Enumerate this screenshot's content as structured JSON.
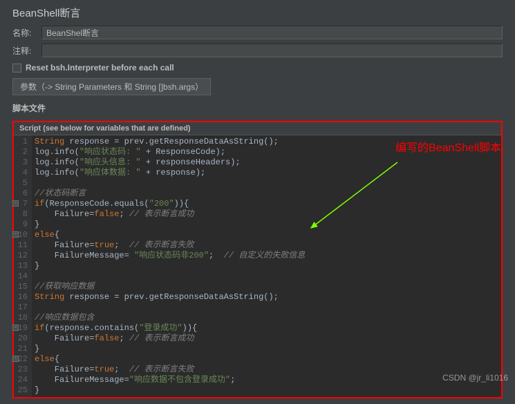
{
  "page_title": "BeanShell断言",
  "name_label": "名称:",
  "name_value": "BeanShel断言",
  "comment_label": "注释:",
  "comment_value": "",
  "reset_checkbox_label": "Reset bsh.Interpreter before each call",
  "params_label": "参数（-> String Parameters 和 String []bsh.args）",
  "script_file_label": "脚本文件",
  "script_header": "Script (see below for variables that are defined)",
  "annotation_text": "编写的BeanShell脚本",
  "watermark": "CSDN @jr_li1016",
  "chart_data": {
    "type": "table",
    "language": "java-beanshell",
    "code_lines": [
      {
        "n": 1,
        "tokens": [
          {
            "t": "kw",
            "v": "String"
          },
          {
            "t": "plain",
            "v": " response = prev.getResponseDataAsString();"
          }
        ]
      },
      {
        "n": 2,
        "tokens": [
          {
            "t": "plain",
            "v": "log.info("
          },
          {
            "t": "str",
            "v": "\"响应状态码: \""
          },
          {
            "t": "plain",
            "v": " + ResponseCode);"
          }
        ]
      },
      {
        "n": 3,
        "tokens": [
          {
            "t": "plain",
            "v": "log.info("
          },
          {
            "t": "str",
            "v": "\"响应头信息: \""
          },
          {
            "t": "plain",
            "v": " + responseHeaders);"
          }
        ]
      },
      {
        "n": 4,
        "tokens": [
          {
            "t": "plain",
            "v": "log.info("
          },
          {
            "t": "str",
            "v": "\"响应体数据: \""
          },
          {
            "t": "plain",
            "v": " + response);"
          }
        ]
      },
      {
        "n": 5,
        "tokens": []
      },
      {
        "n": 6,
        "tokens": [
          {
            "t": "cmt",
            "v": "//状态码断言"
          }
        ]
      },
      {
        "n": 7,
        "fold": true,
        "tokens": [
          {
            "t": "kw",
            "v": "if"
          },
          {
            "t": "plain",
            "v": "(ResponseCode.equals("
          },
          {
            "t": "str",
            "v": "\"200\""
          },
          {
            "t": "plain",
            "v": ")){"
          }
        ]
      },
      {
        "n": 8,
        "tokens": [
          {
            "t": "plain",
            "v": "    Failure="
          },
          {
            "t": "kw",
            "v": "false"
          },
          {
            "t": "plain",
            "v": "; "
          },
          {
            "t": "cmt",
            "v": "// 表示断言成功"
          }
        ]
      },
      {
        "n": 9,
        "tokens": [
          {
            "t": "plain",
            "v": "}"
          }
        ]
      },
      {
        "n": 10,
        "fold": true,
        "tokens": [
          {
            "t": "kw",
            "v": "else"
          },
          {
            "t": "plain",
            "v": "{"
          }
        ]
      },
      {
        "n": 11,
        "tokens": [
          {
            "t": "plain",
            "v": "    Failure="
          },
          {
            "t": "kw",
            "v": "true"
          },
          {
            "t": "plain",
            "v": ";  "
          },
          {
            "t": "cmt",
            "v": "// 表示断言失败"
          }
        ]
      },
      {
        "n": 12,
        "tokens": [
          {
            "t": "plain",
            "v": "    FailureMessage= "
          },
          {
            "t": "str",
            "v": "\"响应状态码非200\""
          },
          {
            "t": "plain",
            "v": ";  "
          },
          {
            "t": "cmt",
            "v": "// 自定义的失败信息"
          }
        ]
      },
      {
        "n": 13,
        "tokens": [
          {
            "t": "plain",
            "v": "}"
          }
        ]
      },
      {
        "n": 14,
        "tokens": []
      },
      {
        "n": 15,
        "tokens": [
          {
            "t": "cmt",
            "v": "//获取响应数据"
          }
        ]
      },
      {
        "n": 16,
        "tokens": [
          {
            "t": "kw",
            "v": "String"
          },
          {
            "t": "plain",
            "v": " response = prev.getResponseDataAsString();"
          }
        ]
      },
      {
        "n": 17,
        "tokens": []
      },
      {
        "n": 18,
        "tokens": [
          {
            "t": "cmt",
            "v": "//响应数据包含"
          }
        ]
      },
      {
        "n": 19,
        "fold": true,
        "tokens": [
          {
            "t": "kw",
            "v": "if"
          },
          {
            "t": "plain",
            "v": "(response.contains("
          },
          {
            "t": "str",
            "v": "\"登录成功\""
          },
          {
            "t": "plain",
            "v": ")){"
          }
        ]
      },
      {
        "n": 20,
        "tokens": [
          {
            "t": "plain",
            "v": "    Failure="
          },
          {
            "t": "kw",
            "v": "false"
          },
          {
            "t": "plain",
            "v": "; "
          },
          {
            "t": "cmt",
            "v": "// 表示断言成功"
          }
        ]
      },
      {
        "n": 21,
        "tokens": [
          {
            "t": "plain",
            "v": "}"
          }
        ]
      },
      {
        "n": 22,
        "fold": true,
        "tokens": [
          {
            "t": "kw",
            "v": "else"
          },
          {
            "t": "plain",
            "v": "{"
          }
        ]
      },
      {
        "n": 23,
        "tokens": [
          {
            "t": "plain",
            "v": "    Failure="
          },
          {
            "t": "kw",
            "v": "true"
          },
          {
            "t": "plain",
            "v": ";  "
          },
          {
            "t": "cmt",
            "v": "// 表示断言失败"
          }
        ]
      },
      {
        "n": 24,
        "tokens": [
          {
            "t": "plain",
            "v": "    FailureMessage="
          },
          {
            "t": "str",
            "v": "\"响应数据不包含登录成功\""
          },
          {
            "t": "plain",
            "v": ";"
          }
        ]
      },
      {
        "n": 25,
        "tokens": [
          {
            "t": "plain",
            "v": "}"
          }
        ]
      }
    ]
  }
}
